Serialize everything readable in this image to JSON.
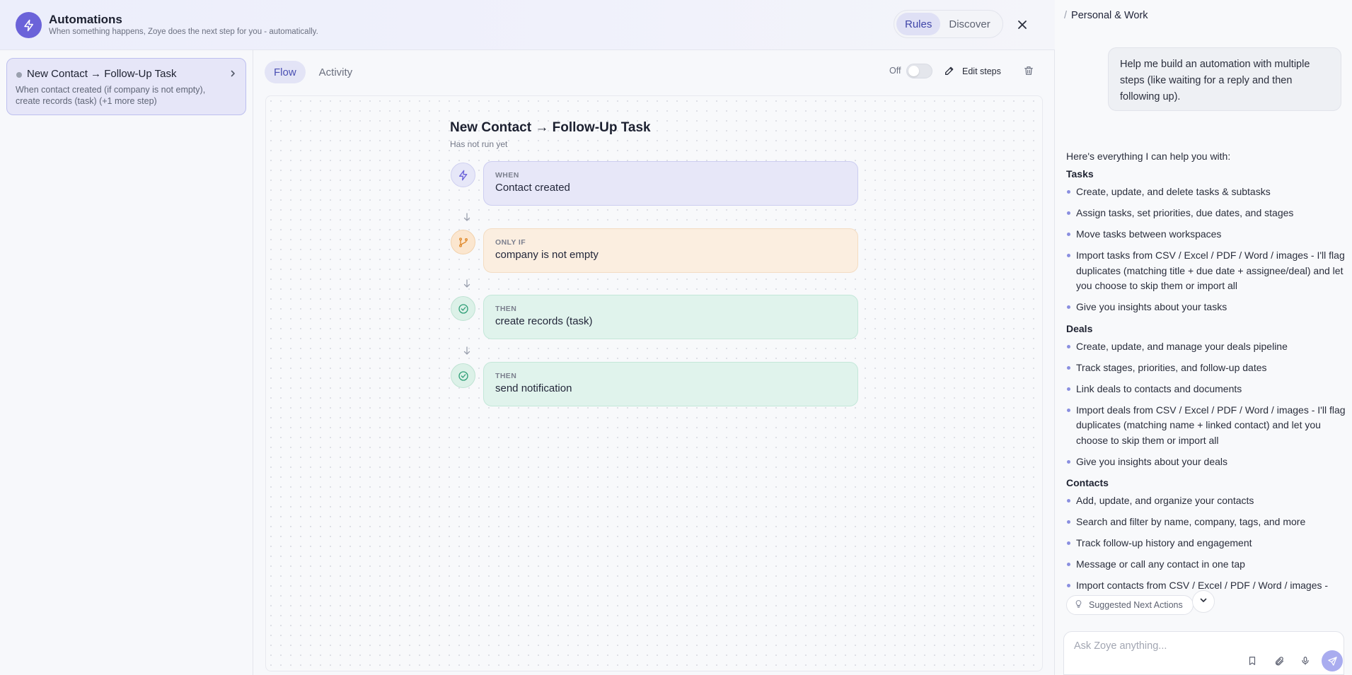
{
  "header": {
    "title": "Automations",
    "subtitle": "When something happens, Zoye does the next step for you - automatically.",
    "modes": [
      {
        "label": "Rules",
        "active": true
      },
      {
        "label": "Discover",
        "active": false
      }
    ],
    "icons": {
      "logo": "lightning-icon",
      "close": "close-icon"
    }
  },
  "rules": [
    {
      "name": "New Contact → Follow-Up Task",
      "description": "When contact created (if company is not empty), create records (task) (+1 more step)",
      "status": "inactive"
    }
  ],
  "panel": {
    "tabs": [
      {
        "label": "Flow",
        "active": true
      },
      {
        "label": "Activity",
        "active": false
      }
    ],
    "toggle_label": "Off",
    "toggle_on": false,
    "edit_label": "Edit steps"
  },
  "flow": {
    "title": "New Contact → Follow-Up Task",
    "status": "Has not run yet",
    "steps": [
      {
        "kind": "WHEN",
        "text": "Contact created",
        "icon": "lightning-icon",
        "tone": "#6b63d9"
      },
      {
        "kind": "ONLY IF",
        "text": "company is not empty",
        "icon": "branch-icon",
        "tone": "#e08a2c"
      },
      {
        "kind": "THEN",
        "text": "create records (task)",
        "icon": "check-circle-icon",
        "tone": "#2f9e77"
      },
      {
        "kind": "THEN",
        "text": "send notification",
        "icon": "check-circle-icon",
        "tone": "#2f9e77"
      }
    ]
  },
  "chat": {
    "breadcrumb": "Personal & Work",
    "user_message": "Help me build an automation with multiple steps (like waiting for a reply and then following up).",
    "assistant_intro": "Here's everything I can help you with:",
    "sections": [
      {
        "title": "Tasks",
        "items": [
          "Create, update, and delete tasks & subtasks",
          "Assign tasks, set priorities, due dates, and stages",
          "Move tasks between workspaces",
          "Import tasks from CSV / Excel / PDF / Word / images - I'll flag duplicates (matching title + due date + assignee/deal) and let you choose to skip them or import all",
          "Give you insights about your tasks"
        ]
      },
      {
        "title": "Deals",
        "items": [
          "Create, update, and manage your deals pipeline",
          "Track stages, priorities, and follow-up dates",
          "Link deals to contacts and documents",
          "Import deals from CSV / Excel / PDF / Word / images - I'll flag duplicates (matching name + linked contact) and let you choose to skip them or import all",
          "Give you insights about your deals"
        ]
      },
      {
        "title": "Contacts",
        "items": [
          "Add, update, and organize your contacts",
          "Search and filter by name, company, tags, and more",
          "Track follow-up history and engagement",
          "Message or call any contact in one tap",
          "Import contacts from CSV / Excel / PDF / Word / images -"
        ]
      }
    ],
    "suggested_label": "Suggested Next Actions",
    "input_placeholder": "Ask Zoye anything...",
    "composer_icons": [
      "bookmark-icon",
      "paperclip-icon",
      "microphone-icon",
      "send-icon"
    ]
  }
}
